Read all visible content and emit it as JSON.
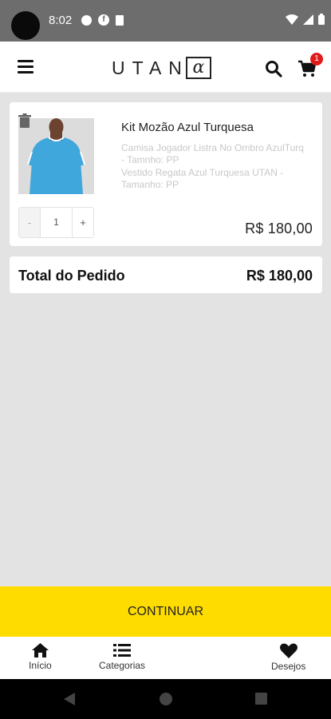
{
  "status_bar": {
    "time": "8:02"
  },
  "header": {
    "logo_text": "UTAN",
    "logo_mark": "α",
    "cart_count": "1"
  },
  "cart_item": {
    "name": "Kit Mozão Azul Turquesa",
    "components": [
      "Camisa Jogador Listra No Ombro AzulTurq - Tamnho: PP",
      "Vestido Regata Azul Turquesa UTAN - Tamanho: PP"
    ],
    "quantity": "1",
    "minus_label": "-",
    "plus_label": "+",
    "price": "R$  180,00"
  },
  "order_total": {
    "label": "Total do Pedido",
    "value": "R$  180,00"
  },
  "continue_label": "CONTINUAR",
  "bottom_nav": {
    "items": [
      {
        "label": "Início",
        "icon": "home-icon"
      },
      {
        "label": "Categorias",
        "icon": "list-icon"
      },
      {
        "label": "Desejos",
        "icon": "heart-icon"
      }
    ]
  },
  "colors": {
    "accent": "#ffdc00",
    "badge": "#e11b1b",
    "background": "#e3e3e3"
  }
}
